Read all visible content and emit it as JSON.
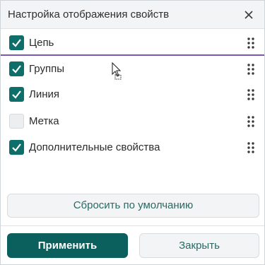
{
  "dialog": {
    "title": "Настройка отображения свойств",
    "close_icon": "close-icon"
  },
  "properties": [
    {
      "label": "Цепь",
      "checked": true
    },
    {
      "label": "Группы",
      "checked": true
    },
    {
      "label": "Линия",
      "checked": true
    },
    {
      "label": "Метка",
      "checked": false
    },
    {
      "label": "Дополнительные свойства",
      "checked": true
    }
  ],
  "buttons": {
    "reset_label": "Сбросить по умолчанию",
    "apply_label": "Применить",
    "close_label": "Закрыть"
  },
  "colors": {
    "accent": "#0e6e6a",
    "apply_bg": "#0b5f5c",
    "drop_indicator": "#7b57b8"
  },
  "icons": {
    "row_handle": "drag-handle-icon",
    "checkbox_mark": "checkmark-icon",
    "pointer": "move-cursor-icon"
  }
}
